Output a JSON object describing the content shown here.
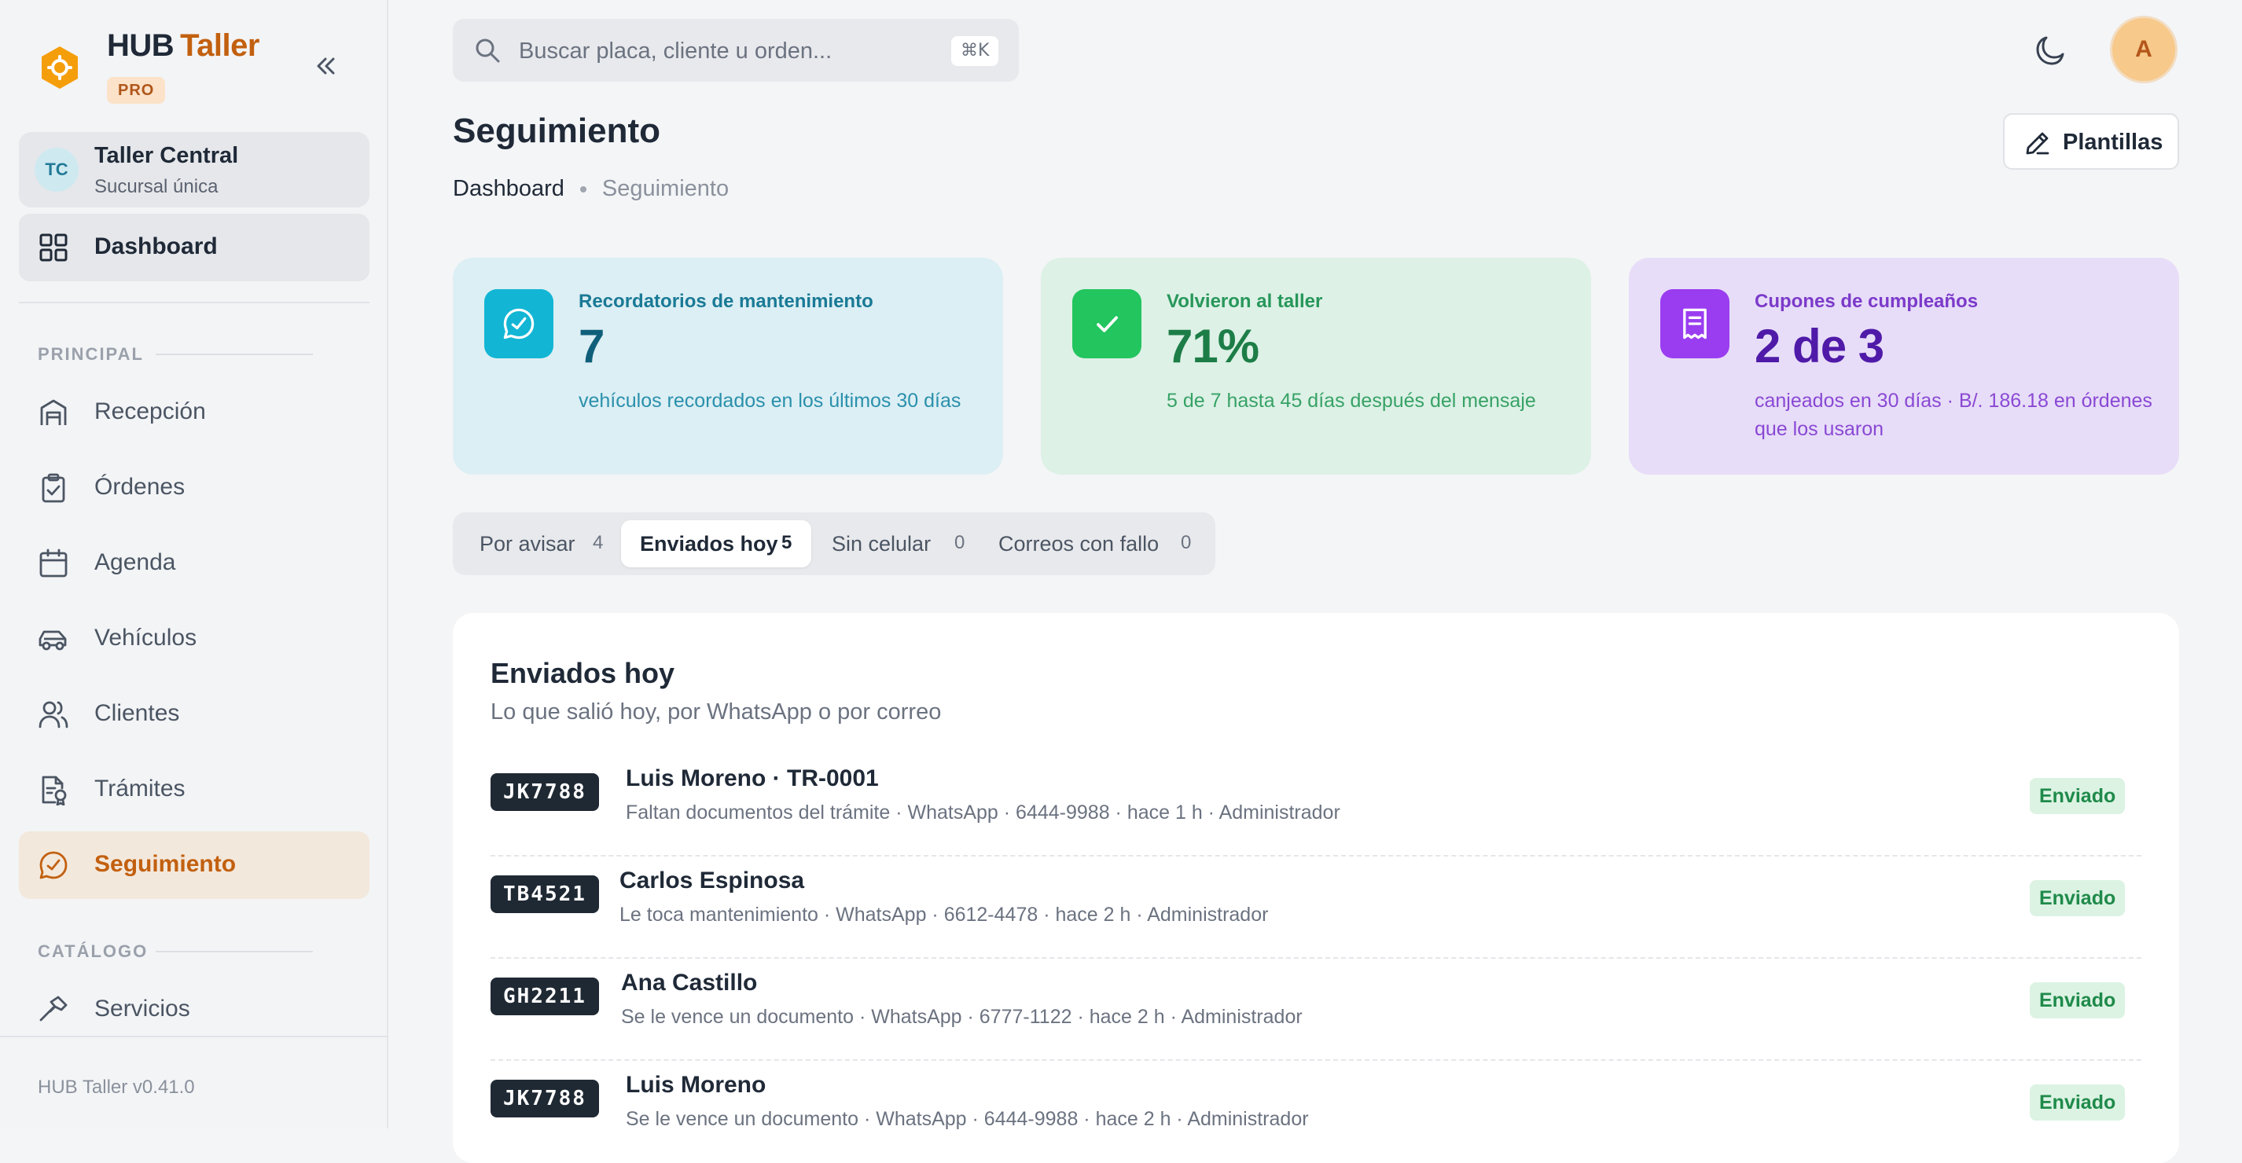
{
  "brand": {
    "name_part1": "HUB",
    "name_part2": "Taller",
    "badge": "PRO",
    "logo_icon": "gear-hexagon-icon"
  },
  "branch": {
    "initials": "TC",
    "name": "Taller Central",
    "subtitle": "Sucursal única"
  },
  "sidebar": {
    "dashboard": {
      "label": "Dashboard",
      "icon": "grid-icon"
    },
    "sections": [
      {
        "label": "PRINCIPAL",
        "items": [
          {
            "label": "Recepción",
            "icon": "garage-icon"
          },
          {
            "label": "Órdenes",
            "icon": "clipboard-check-icon"
          },
          {
            "label": "Agenda",
            "icon": "calendar-icon"
          },
          {
            "label": "Vehículos",
            "icon": "car-icon"
          },
          {
            "label": "Clientes",
            "icon": "users-icon"
          },
          {
            "label": "Trámites",
            "icon": "document-badge-icon"
          },
          {
            "label": "Seguimiento",
            "icon": "chat-check-icon",
            "active": true
          }
        ]
      },
      {
        "label": "CATÁLOGO",
        "items": [
          {
            "label": "Servicios",
            "icon": "hammer-icon"
          }
        ]
      }
    ],
    "version": "HUB Taller v0.41.0"
  },
  "search": {
    "placeholder": "Buscar placa, cliente u orden...",
    "shortcut": "⌘K"
  },
  "user": {
    "initial": "A"
  },
  "header": {
    "title": "Seguimiento",
    "breadcrumb": [
      "Dashboard",
      "Seguimiento"
    ],
    "templates_button": "Plantillas"
  },
  "stats": [
    {
      "title": "Recordatorios de mantenimiento",
      "value": "7",
      "description": "vehículos recordados en los últimos 30 días",
      "icon": "chat-check-icon",
      "color": "#12b6d4"
    },
    {
      "title": "Volvieron al taller",
      "value": "71%",
      "description": "5 de 7 hasta 45 días después del mensaje",
      "icon": "check-icon",
      "color": "#22c55e"
    },
    {
      "title": "Cupones de cumpleaños",
      "value": "2 de 3",
      "description": "canjeados en 30 días · B/. 186.18 en órdenes que los usaron",
      "icon": "receipt-icon",
      "color": "#9a3df0"
    }
  ],
  "tabs": [
    {
      "label": "Por avisar",
      "count": "4"
    },
    {
      "label": "Enviados hoy",
      "count": "5",
      "active": true
    },
    {
      "label": "Sin celular",
      "count": "0"
    },
    {
      "label": "Correos con fallo",
      "count": "0"
    }
  ],
  "panel": {
    "title": "Enviados hoy",
    "subtitle": "Lo que salió hoy, por WhatsApp o por correo",
    "rows": [
      {
        "plate": "JK7788",
        "title": "Luis Moreno · TR-0001",
        "meta": "Faltan documentos del trámite · WhatsApp · 6444-9988 · hace 1 h · Administrador",
        "status": "Enviado"
      },
      {
        "plate": "TB4521",
        "title": "Carlos Espinosa",
        "meta": "Le toca mantenimiento · WhatsApp · 6612-4478 · hace 2 h · Administrador",
        "status": "Enviado"
      },
      {
        "plate": "GH2211",
        "title": "Ana Castillo",
        "meta": "Se le vence un documento · WhatsApp · 6777-1122 · hace 2 h · Administrador",
        "status": "Enviado"
      },
      {
        "plate": "JK7788",
        "title": "Luis Moreno",
        "meta": "Se le vence un documento · WhatsApp · 6444-9988 · hace 2 h · Administrador",
        "status": "Enviado"
      }
    ]
  },
  "colors": {
    "accent": "#c2600f",
    "success": "#1f8a4a"
  }
}
